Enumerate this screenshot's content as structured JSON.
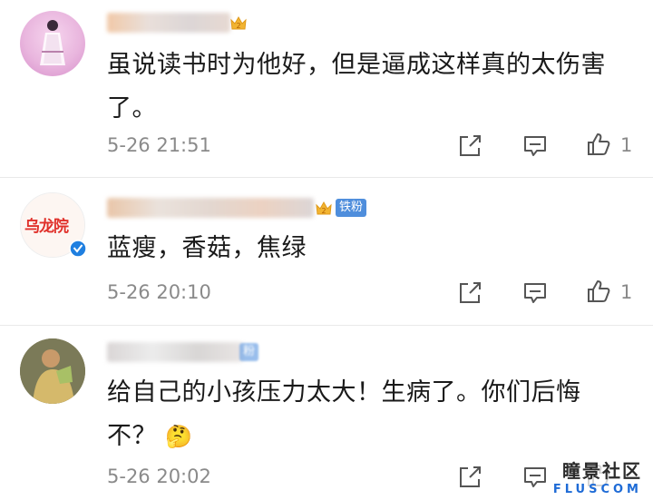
{
  "comments": [
    {
      "text_lines": [
        "虽说读书时为他好，但是逼成这样真的太伤害",
        "了。"
      ],
      "time": "5-26 21:51",
      "likes": "1"
    },
    {
      "badge_label": "铁粉",
      "avatar_text": "乌龙院",
      "text_lines": [
        "蓝瘦，香菇，焦绿"
      ],
      "time": "5-26 20:10",
      "likes": "1"
    },
    {
      "badge_label": "粉",
      "text_lines": [
        "给自己的小孩压力太大！生病了。你们后悔",
        "不？"
      ],
      "emoji": "🤔",
      "time": "5-26 20:02",
      "likes": ""
    }
  ],
  "icons": [
    "share-icon",
    "reply-icon",
    "like-icon",
    "thinking-emoji",
    "crown-badge-icon",
    "verified-icon"
  ],
  "watermark": {
    "top": "瞳景社区",
    "bottom": "FLUSCOM"
  },
  "colors": {
    "time_gray": "#8a8a8a",
    "badge_blue": "#4f8edc",
    "crown_gold": "#f2b431",
    "verified_blue": "#1f7fe0"
  }
}
